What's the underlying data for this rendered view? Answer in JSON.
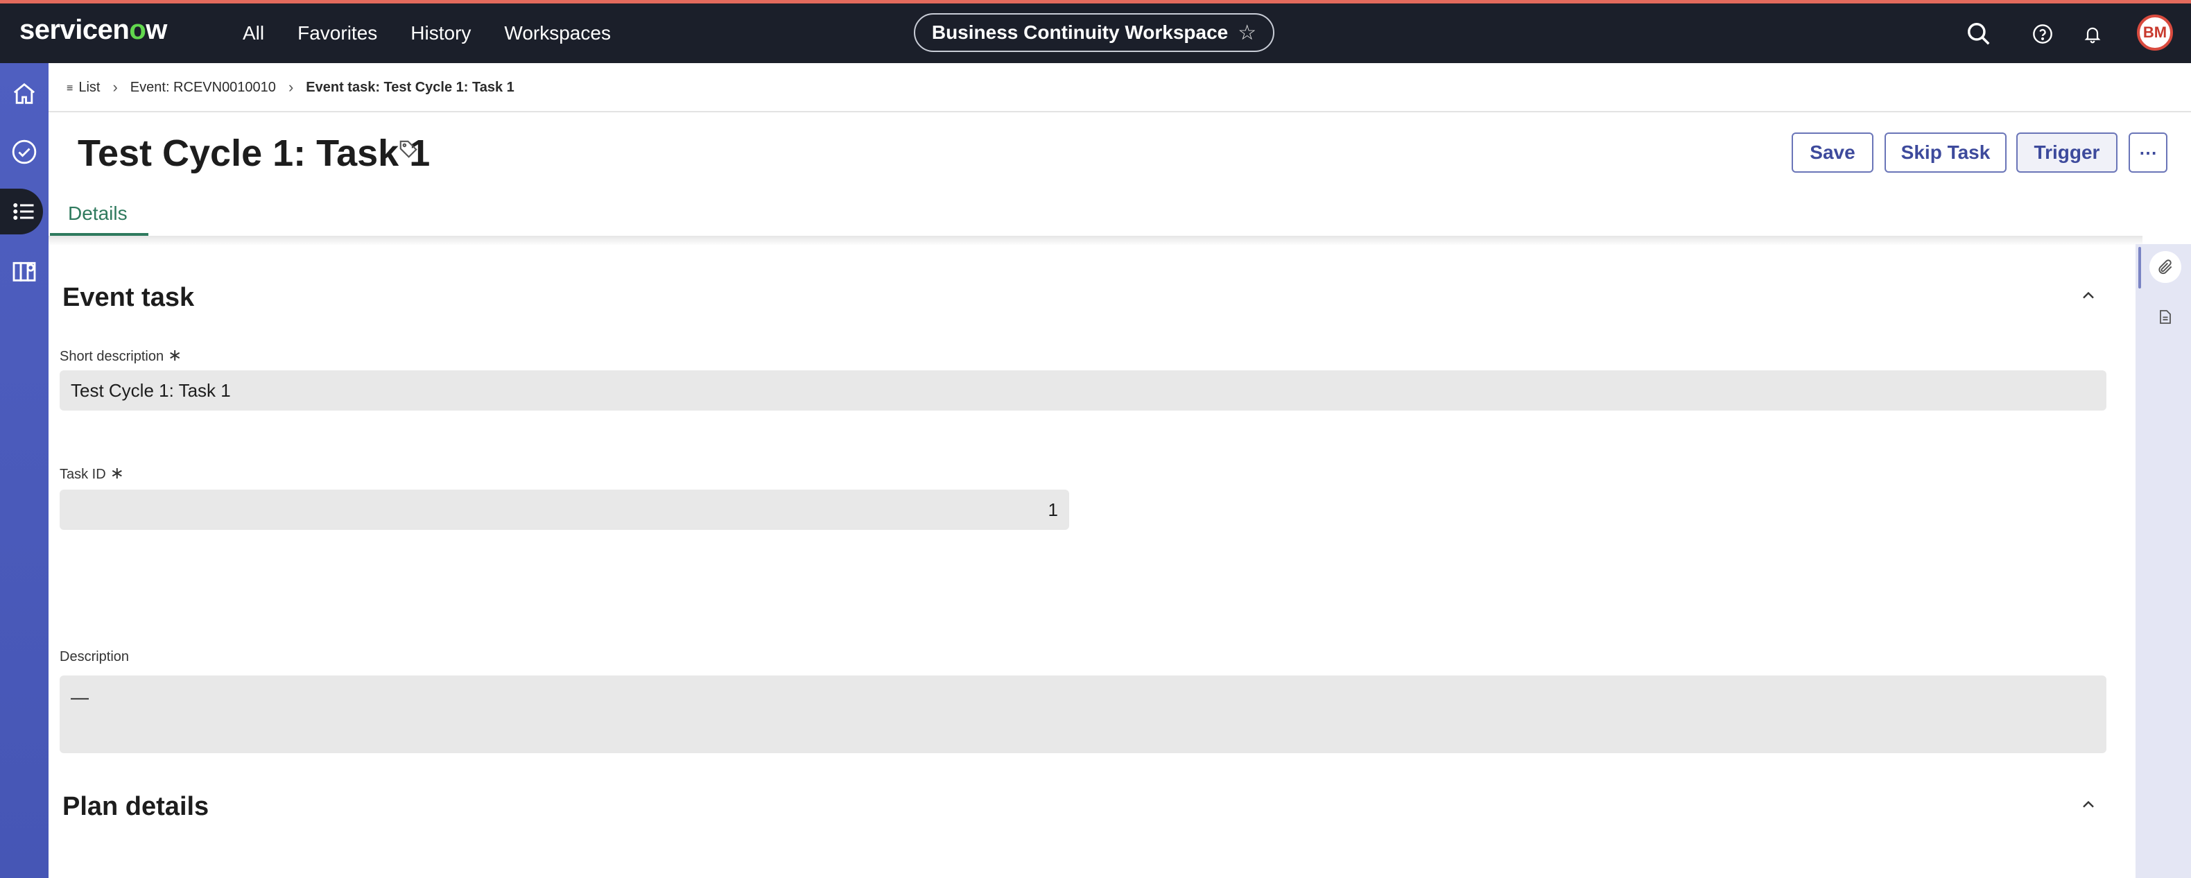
{
  "topnav": {
    "logo": {
      "prefix": "servicen",
      "o": "o",
      "suffix": "w"
    },
    "links": [
      "All",
      "Favorites",
      "History",
      "Workspaces"
    ],
    "workspace_name": "Business Continuity Workspace",
    "avatar_initials": "BM"
  },
  "breadcrumb": {
    "items": [
      "List",
      "Event: RCEVN0010010",
      "Event task: Test Cycle 1: Task 1"
    ]
  },
  "header": {
    "title": "Test Cycle 1: Task 1",
    "actions": {
      "save": "Save",
      "skip": "Skip Task",
      "trigger": "Trigger",
      "more": "⋯"
    },
    "tabs": [
      "Details"
    ]
  },
  "form": {
    "section_event_task": "Event task",
    "short_description": {
      "label": "Short description",
      "required_mark": "∗",
      "value": "Test Cycle 1: Task 1"
    },
    "task_id": {
      "label": "Task ID",
      "required_mark": "∗",
      "value": "1"
    },
    "description": {
      "label": "Description",
      "value": "—"
    },
    "section_plan_details": "Plan details"
  },
  "colors": {
    "topnav_bg": "#1b1f2a",
    "rail_bg": "#4f5fc0",
    "accent_green": "#2f7a5e",
    "button_text": "#3d4a9c",
    "field_bg": "#e8e8e8"
  },
  "icons": {
    "rail": [
      "home-icon",
      "checkmark-icon",
      "list-icon",
      "map-icon"
    ],
    "topbar": [
      "search-icon",
      "help-icon",
      "bell-icon"
    ],
    "right_rail": [
      "paperclip-icon",
      "document-icon"
    ]
  }
}
